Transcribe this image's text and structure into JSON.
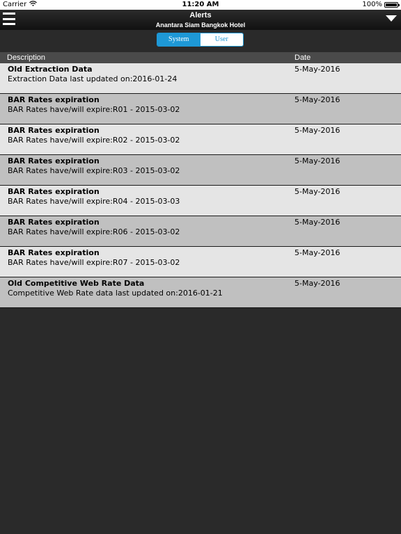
{
  "status_bar": {
    "carrier": "Carrier",
    "time": "11:20 AM",
    "battery": "100%",
    "icons": [
      "wifi-icon",
      "battery-icon"
    ]
  },
  "nav": {
    "title": "Alerts",
    "subtitle": "Anantara Siam Bangkok Hotel",
    "icons": [
      "menu-icon",
      "dropdown-arrow-icon"
    ]
  },
  "segments": {
    "system": "System",
    "user": "User",
    "selected": "System",
    "accent_color": "#1e98d6"
  },
  "table": {
    "columns": [
      "Description",
      "Date"
    ],
    "rows": [
      {
        "title": "Old Extraction Data",
        "detail": "Extraction Data last updated on:2016-01-24",
        "date": "5-May-2016"
      },
      {
        "title": "BAR Rates expiration",
        "detail": "BAR Rates have/will expire:R01 - 2015-03-02",
        "date": "5-May-2016"
      },
      {
        "title": "BAR Rates expiration",
        "detail": "BAR Rates have/will expire:R02 - 2015-03-02",
        "date": "5-May-2016"
      },
      {
        "title": "BAR Rates expiration",
        "detail": "BAR Rates have/will expire:R03 - 2015-03-02",
        "date": "5-May-2016"
      },
      {
        "title": "BAR Rates expiration",
        "detail": "BAR Rates have/will expire:R04 - 2015-03-03",
        "date": "5-May-2016"
      },
      {
        "title": "BAR Rates expiration",
        "detail": "BAR Rates have/will expire:R06 - 2015-03-02",
        "date": "5-May-2016"
      },
      {
        "title": "BAR Rates expiration",
        "detail": "BAR Rates have/will expire:R07 - 2015-03-02",
        "date": "5-May-2016"
      },
      {
        "title": "Old Competitive Web Rate Data",
        "detail": "Competitive Web Rate data last updated on:2016-01-21",
        "date": "5-May-2016"
      }
    ]
  }
}
